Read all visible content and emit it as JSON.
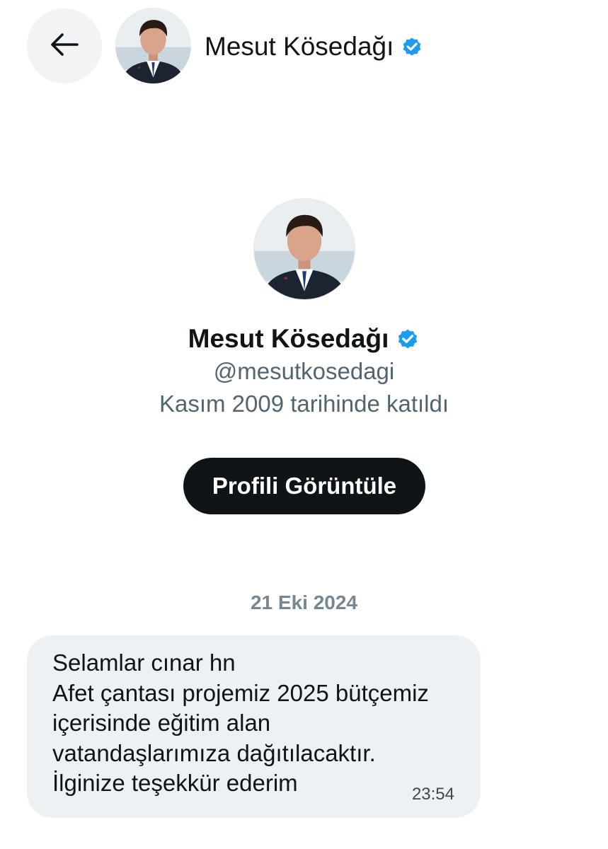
{
  "header": {
    "name": "Mesut Kösedağı",
    "back_icon": "arrow-left-icon",
    "verified_icon": "verified-badge-icon"
  },
  "profile": {
    "name": "Mesut Kösedağı",
    "handle": "@mesutkosedagi",
    "joined": "Kasım 2009 tarihinde katıldı",
    "view_profile_label": "Profili Görüntüle"
  },
  "conversation": {
    "date": "21 Eki 2024",
    "messages": [
      {
        "lines": [
          "Selamlar cınar hn",
          "Afet çantası projemiz 2025 bütçemiz",
          "içerisinde eğitim alan",
          "vatandaşlarımıza dağıtılacaktır.",
          "İlginize teşekkür ederim"
        ],
        "time": "23:54"
      }
    ]
  },
  "colors": {
    "verified": "#1d9bf0",
    "text_primary": "#0f1419",
    "text_secondary": "#536471",
    "date_separator": "#768692",
    "button_background": "#0f1419",
    "bubble_background": "#eef1f3",
    "back_button_background": "#f2f3f4"
  }
}
